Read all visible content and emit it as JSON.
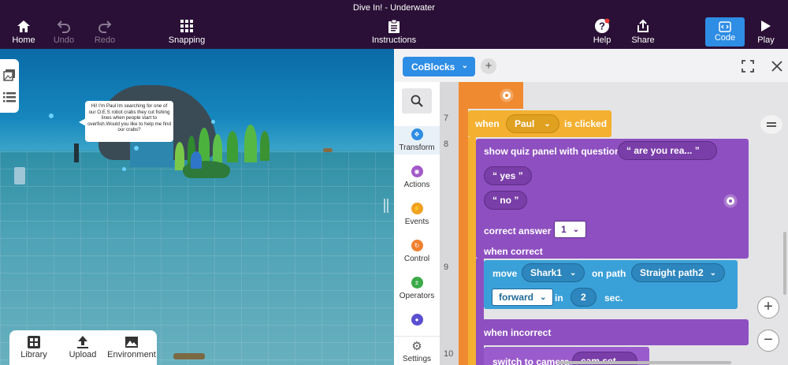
{
  "window": {
    "title": "Dive In! - Underwater"
  },
  "toolbar": {
    "home": "Home",
    "undo": "Undo",
    "redo": "Redo",
    "snapping": "Snapping",
    "instructions": "Instructions",
    "help": "Help",
    "share": "Share",
    "code": "Code",
    "play": "Play"
  },
  "scene": {
    "speech": "Hi! I'm Paul Im searching for one of our O.E.S robot crabs they cut fishing lines  when people start to overfish.Would you like to help me find our crabs?"
  },
  "bottom_bar": {
    "library": "Library",
    "upload": "Upload",
    "environment": "Environment"
  },
  "code_panel": {
    "editor_name": "CoBlocks",
    "categories": [
      {
        "label": "Transform",
        "color": "#2e8de4"
      },
      {
        "label": "Actions",
        "color": "#a259c8"
      },
      {
        "label": "Events",
        "color": "#f0a020"
      },
      {
        "label": "Control",
        "color": "#f08030"
      },
      {
        "label": "Operators",
        "color": "#3aaa48"
      },
      {
        "label": "",
        "color": "#5a4fd0"
      },
      {
        "label": "Settings",
        "color": "#555555"
      }
    ],
    "line_numbers": [
      "7",
      "8",
      "9",
      "10"
    ],
    "blocks": {
      "when": "when",
      "paul": "Paul",
      "is_clicked": "is clicked",
      "show_quiz": "show quiz panel with question",
      "question_value": "“  are you rea... ”",
      "yes": "“  yes  ”",
      "no": "“  no  ”",
      "correct_answer": "correct answer",
      "correct_answer_value": "1",
      "when_correct": "when correct",
      "move": "move",
      "shark": "Shark1",
      "on_path": "on path",
      "path": "Straight path2",
      "direction": "forward",
      "in": "in",
      "seconds": "2",
      "sec": "sec.",
      "when_incorrect": "when incorrect",
      "switch_camera": "switch to camera",
      "cam": "cam set"
    }
  }
}
